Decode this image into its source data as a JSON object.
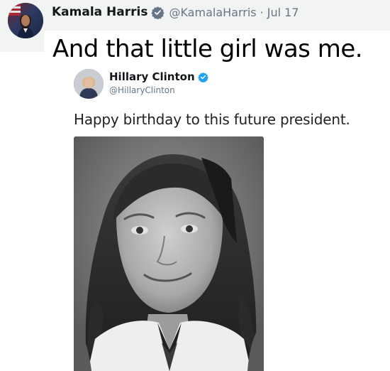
{
  "tweet": {
    "author_name": "Kamala Harris",
    "author_handle": "@KamalaHarris",
    "separator": "·",
    "date": "Jul 17",
    "text": "And that little girl was me.",
    "avatar_icon": "kamala-harris-avatar",
    "verified_icon": "verified-badge-icon"
  },
  "quoted_tweet": {
    "author_name": "Hillary Clinton",
    "author_handle": "@HillaryClinton",
    "text": "Happy birthday to this future president.",
    "avatar_icon": "hillary-clinton-avatar",
    "verified_icon": "verified-badge-icon",
    "verified_color": "#1da1f2",
    "photo": "black-and-white-childhood-portrait"
  },
  "colors": {
    "header_bg": "#f2f3f3",
    "handle_gray": "#657786",
    "verified_gray": "#657786",
    "verified_blue": "#1da1f2"
  }
}
